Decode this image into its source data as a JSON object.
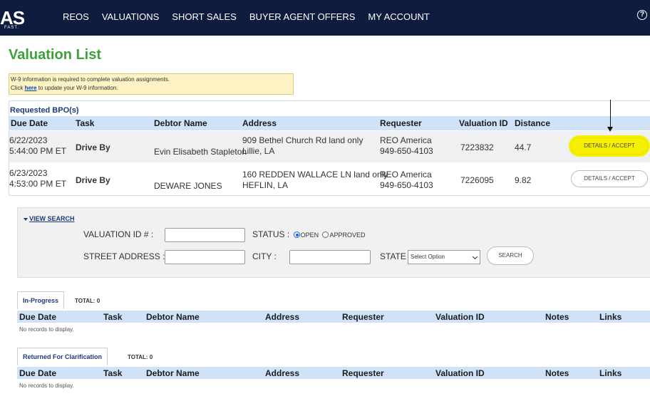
{
  "nav": {
    "logo_text": "AS",
    "logo_sub": "FAST.",
    "items": [
      "REOS",
      "VALUATIONS",
      "SHORT SALES",
      "BUYER AGENT OFFERS",
      "MY ACCOUNT"
    ],
    "help_icon": "?"
  },
  "page": {
    "title": "Valuation List"
  },
  "notice": {
    "line1": "W-9 information is required to complete valuation assignments.",
    "line2_pre": "Click ",
    "line2_link": "here",
    "line2_post": " to update your W-9 information."
  },
  "requested": {
    "title": "Requested BPO(s)",
    "headers": [
      "Due Date",
      "Task",
      "Debtor Name",
      "Address",
      "Requester",
      "Valuation ID",
      "Distance"
    ],
    "rows": [
      {
        "due_date": "6/22/2023",
        "due_time": "5:44:00 PM ET",
        "task": "Drive By",
        "debtor": "Evin Elisabeth Stapleton",
        "address1": "909 Bethel Church Rd land only",
        "address2": "Lillie, LA",
        "requester1": "REO America",
        "requester2": "949-650-4103",
        "valuation_id": "7223832",
        "distance": "44.7",
        "action": "DETAILS / ACCEPT"
      },
      {
        "due_date": "6/23/2023",
        "due_time": "4:53:00 PM ET",
        "task": "Drive By",
        "debtor": "DEWARE JONES",
        "address1": "160 REDDEN WALLACE LN land only",
        "address2": "HEFLIN, LA",
        "requester1": "REO America",
        "requester2": "949-650-4103",
        "valuation_id": "7226095",
        "distance": "9.82",
        "action": "DETAILS / ACCEPT"
      }
    ]
  },
  "search": {
    "toggle": "VIEW SEARCH",
    "valuation_id_label": "VALUATION ID # :",
    "valuation_id_value": "",
    "status_label": "STATUS :",
    "status_open": "OPEN",
    "status_approved": "APPROVED",
    "street_label": "STREET ADDRESS :",
    "street_value": "",
    "city_label": "CITY :",
    "city_value": "",
    "state_label": "STATE :",
    "state_value": "Select Option",
    "search_button": "SEARCH"
  },
  "in_progress": {
    "tab": "In-Progress",
    "total": "TOTAL: 0",
    "headers": [
      "Due Date",
      "Task",
      "Debtor Name",
      "Address",
      "Requester",
      "Valuation ID",
      "Notes",
      "Links"
    ],
    "empty": "No records to display."
  },
  "returned": {
    "tab": "Returned For Clarification",
    "total": "TOTAL: 0",
    "headers": [
      "Due Date",
      "Task",
      "Debtor Name",
      "Address",
      "Requester",
      "Valuation ID",
      "Notes",
      "Links"
    ],
    "empty": "No records to display."
  },
  "colors": {
    "navbar": "#0e1c3f",
    "title_green": "#3da23a",
    "header_blue": "#cfe2f7",
    "highlight_yellow": "#f6f000"
  }
}
